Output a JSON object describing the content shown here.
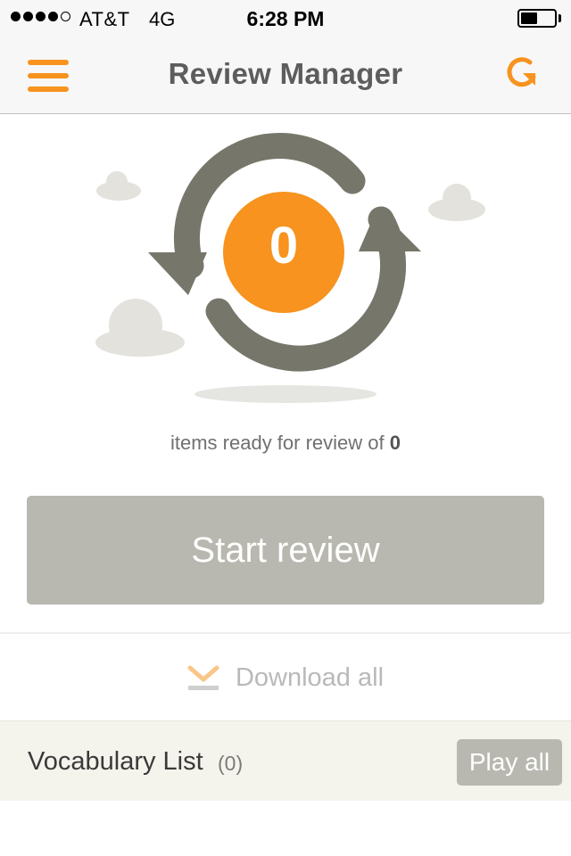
{
  "status_bar": {
    "carrier": "AT&T",
    "network": "4G",
    "time": "6:28 PM",
    "signal_bars": 4,
    "signal_max": 5,
    "battery_level": 0.5
  },
  "nav": {
    "title": "Review Manager",
    "menu_icon": "hamburger-menu-icon",
    "refresh_icon": "refresh-icon",
    "accent_color": "#f7931e"
  },
  "review": {
    "count": "0",
    "caption_prefix": "items ready for review of",
    "caption_total": "0",
    "start_label": "Start review",
    "download_label": "Download all",
    "download_icon": "download-icon"
  },
  "vocabulary": {
    "title": "Vocabulary List",
    "count": "(0)",
    "play_label": "Play all"
  },
  "colors": {
    "accent": "#f7931e",
    "arrows": "#76766a",
    "clouds": "#e3e2dc",
    "button_gray": "#b8b8b0",
    "vocab_bg": "#f5f4ec"
  }
}
